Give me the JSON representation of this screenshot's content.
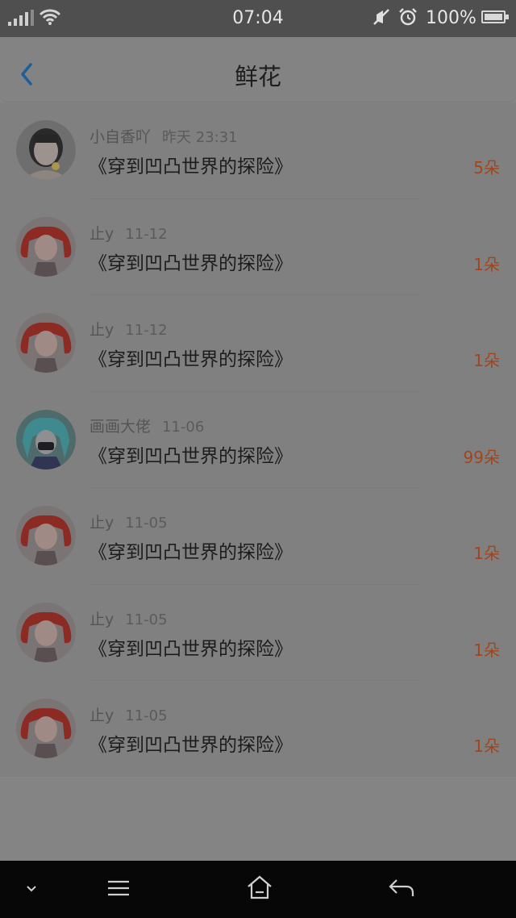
{
  "status_bar": {
    "time": "07:04",
    "battery": "100%"
  },
  "header": {
    "title": "鲜花"
  },
  "items": [
    {
      "user": "小自香吖",
      "date": "昨天 23:31",
      "book": "《穿到凹凸世界的探险》",
      "count": "5朵",
      "avatar": "photo"
    },
    {
      "user": "止y",
      "date": "11-12",
      "book": "《穿到凹凸世界的探险》",
      "count": "1朵",
      "avatar": "red"
    },
    {
      "user": "止y",
      "date": "11-12",
      "book": "《穿到凹凸世界的探险》",
      "count": "1朵",
      "avatar": "red"
    },
    {
      "user": "画画大佬",
      "date": "11-06",
      "book": "《穿到凹凸世界的探险》",
      "count": "99朵",
      "avatar": "teal"
    },
    {
      "user": "止y",
      "date": "11-05",
      "book": "《穿到凹凸世界的探险》",
      "count": "1朵",
      "avatar": "red"
    },
    {
      "user": "止y",
      "date": "11-05",
      "book": "《穿到凹凸世界的探险》",
      "count": "1朵",
      "avatar": "red"
    },
    {
      "user": "止y",
      "date": "11-05",
      "book": "《穿到凹凸世界的探险》",
      "count": "1朵",
      "avatar": "red"
    }
  ],
  "icons": {
    "back": "chevron-left-icon",
    "nav": [
      "chevron-down-icon",
      "menu-icon",
      "home-icon",
      "back-arrow-icon"
    ]
  },
  "colors": {
    "count": "#a3451c",
    "back_arrow": "#1f5f99"
  }
}
